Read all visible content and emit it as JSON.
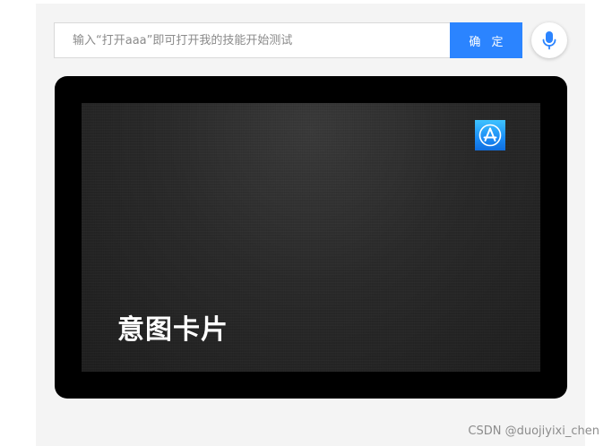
{
  "search": {
    "placeholder": "输入“打开aaa”即可打开我的技能开始测试",
    "value": "",
    "confirm_label": "确 定"
  },
  "icons": {
    "mic": "microphone-icon",
    "app": "app-store-icon"
  },
  "card": {
    "title": "意图卡片"
  },
  "watermark": {
    "text": "CSDN @duojiyixi_chen"
  },
  "colors": {
    "accent": "#2b84ff",
    "card_frame": "#000000",
    "card_background": "#262626",
    "panel_background": "#f4f4f4"
  }
}
